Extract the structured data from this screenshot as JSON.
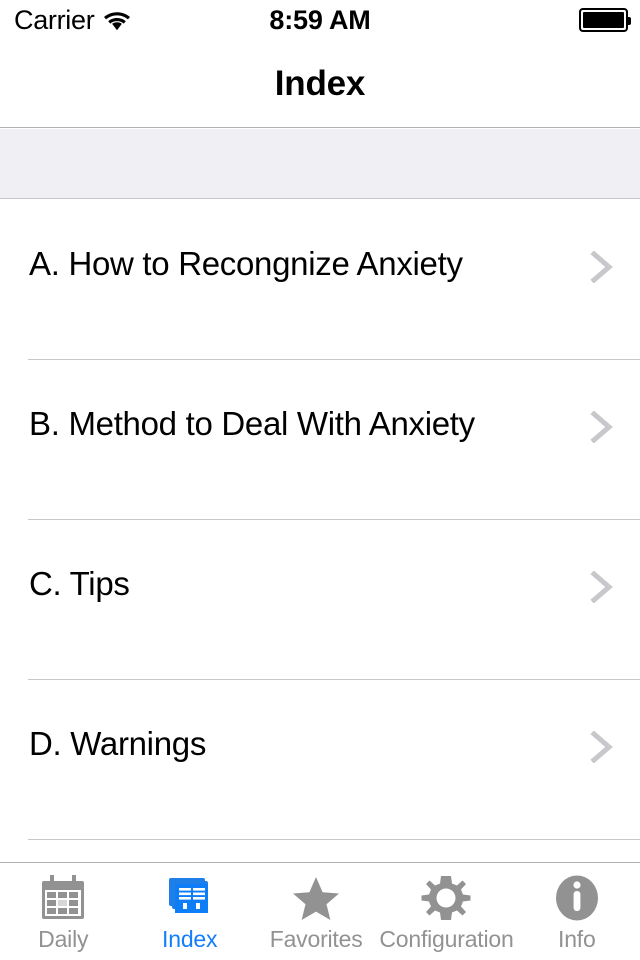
{
  "status_bar": {
    "carrier": "Carrier",
    "wifi_icon": "wifi-icon",
    "time": "8:59 AM",
    "battery_icon": "battery-full-icon"
  },
  "nav_bar": {
    "title": "Index"
  },
  "section_header": {
    "text": ""
  },
  "list": {
    "rows": [
      {
        "label": "A. How to Recongnize Anxiety",
        "accessory": "chevron-right-icon"
      },
      {
        "label": "B. Method to Deal With Anxiety",
        "accessory": "chevron-right-icon"
      },
      {
        "label": "C. Tips",
        "accessory": "chevron-right-icon"
      },
      {
        "label": "D. Warnings",
        "accessory": "chevron-right-icon"
      }
    ]
  },
  "tab_bar": {
    "active_index": 1,
    "active_color": "#147efb",
    "inactive_color": "#929292",
    "items": [
      {
        "label": "Daily",
        "icon": "calendar-icon"
      },
      {
        "label": "Index",
        "icon": "index-cards-icon"
      },
      {
        "label": "Favorites",
        "icon": "star-icon"
      },
      {
        "label": "Configuration",
        "icon": "gear-icon"
      },
      {
        "label": "Info",
        "icon": "info-circle-icon"
      }
    ]
  }
}
